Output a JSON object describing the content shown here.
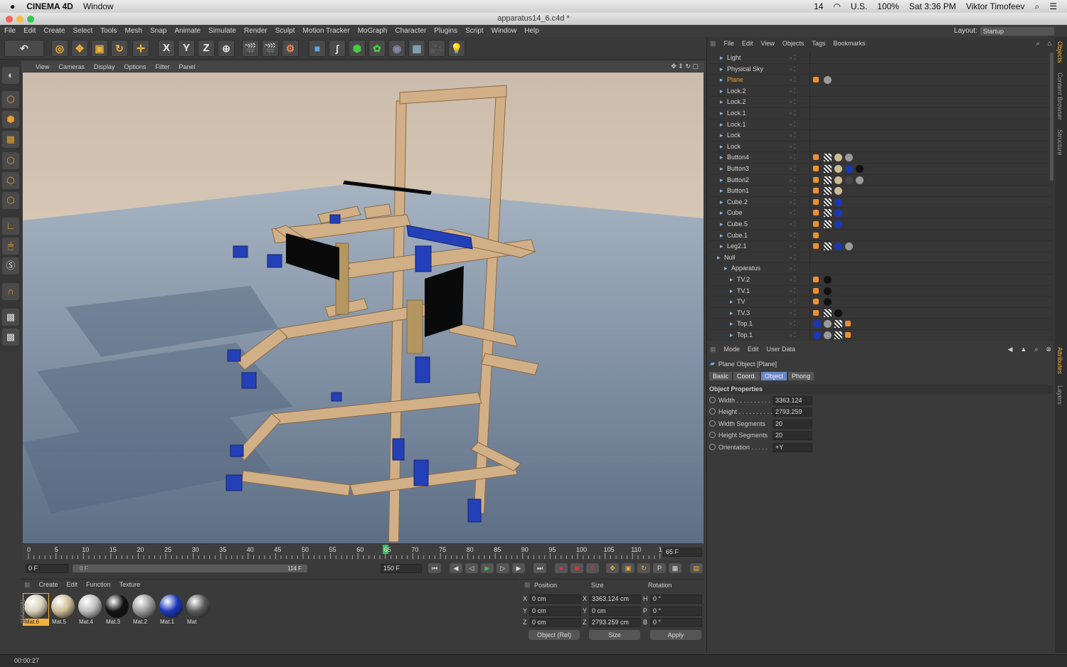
{
  "mac_menubar": {
    "app": "CINEMA 4D",
    "window_menu": "Window",
    "status": [
      "14",
      "U.S.",
      "100%",
      "Sat 3:36 PM",
      "Viktor Timofeev"
    ]
  },
  "window": {
    "title": "apparatus14_6.c4d *"
  },
  "menu": [
    "File",
    "Edit",
    "Create",
    "Select",
    "Tools",
    "Mesh",
    "Snap",
    "Animate",
    "Simulate",
    "Render",
    "Sculpt",
    "Motion Tracker",
    "MoGraph",
    "Character",
    "Plugins",
    "Script",
    "Window",
    "Help"
  ],
  "layout": {
    "label": "Layout:",
    "value": "Startup"
  },
  "toolbar": {
    "axis": [
      "X",
      "Y",
      "Z"
    ]
  },
  "viewport_menu": [
    "View",
    "Cameras",
    "Display",
    "Options",
    "Filter",
    "Panel"
  ],
  "object_manager": {
    "menu": [
      "File",
      "Edit",
      "View",
      "Objects",
      "Tags",
      "Bookmarks"
    ],
    "items": [
      {
        "name": "Light",
        "selected": false
      },
      {
        "name": "Physical Sky",
        "selected": false
      },
      {
        "name": "Plane",
        "selected": true
      },
      {
        "name": "Lock.2",
        "selected": false
      },
      {
        "name": "Lock.2",
        "selected": false
      },
      {
        "name": "Lock.1",
        "selected": false
      },
      {
        "name": "Lock.1",
        "selected": false
      },
      {
        "name": "Lock",
        "selected": false
      },
      {
        "name": "Lock",
        "selected": false
      },
      {
        "name": "Button4",
        "selected": false
      },
      {
        "name": "Button3",
        "selected": false
      },
      {
        "name": "Button2",
        "selected": false
      },
      {
        "name": "Button1",
        "selected": false
      },
      {
        "name": "Cube.2",
        "selected": false
      },
      {
        "name": "Cube",
        "selected": false
      },
      {
        "name": "Cube.5",
        "selected": false
      },
      {
        "name": "Cube.1",
        "selected": false
      },
      {
        "name": "Leg2.1",
        "selected": false
      },
      {
        "name": "Null",
        "selected": false
      },
      {
        "name": "Apparatus",
        "selected": false
      },
      {
        "name": "TV.2",
        "selected": false
      },
      {
        "name": "TV.1",
        "selected": false
      },
      {
        "name": "TV",
        "selected": false
      },
      {
        "name": "TV.3",
        "selected": false
      },
      {
        "name": "Top.1",
        "selected": false
      },
      {
        "name": "Top.1",
        "selected": false
      }
    ]
  },
  "attributes": {
    "menu": [
      "Mode",
      "Edit",
      "User Data"
    ],
    "object_title": "Plane Object [Plane]",
    "tabs": [
      "Basic",
      "Coord.",
      "Object",
      "Phong"
    ],
    "active_tab": "Object",
    "section": "Object Properties",
    "props": [
      {
        "label": "Width . . . . . . . . . . .",
        "value": "3363.124"
      },
      {
        "label": "Height . . . . . . . . . .",
        "value": "2793.259"
      },
      {
        "label": "Width Segments",
        "value": "20"
      },
      {
        "label": "Height Segments",
        "value": "20"
      },
      {
        "label": "Orientation . . . . .",
        "value": "+Y"
      }
    ]
  },
  "side_tabs": [
    "Objects",
    "Content Browser",
    "Structure",
    "Attributes",
    "Layers"
  ],
  "timeline": {
    "ticks": [
      "0",
      "5",
      "10",
      "15",
      "20",
      "25",
      "30",
      "35",
      "40",
      "45",
      "50",
      "55",
      "60",
      "65",
      "70",
      "75",
      "80",
      "85",
      "90",
      "95",
      "100",
      "105",
      "110",
      "1"
    ],
    "current_frame": "65",
    "frame_field": "65 F",
    "start": "0 F",
    "range_start": "0 F",
    "range_end": "114 F",
    "end": "150 F"
  },
  "materials": {
    "menu": [
      "Create",
      "Edit",
      "Function",
      "Texture"
    ],
    "items": [
      {
        "name": "Mat.6",
        "color": "#d8cfb8"
      },
      {
        "name": "Mat.5",
        "color": "#cdbb93"
      },
      {
        "name": "Mat.4",
        "color": "#bdbdbd"
      },
      {
        "name": "Mat.3",
        "color": "#111111"
      },
      {
        "name": "Mat.2",
        "color": "#9a9a9a"
      },
      {
        "name": "Mat.1",
        "color": "#1a37b8"
      },
      {
        "name": "Mat",
        "color": "#5a5a5a"
      }
    ]
  },
  "coords": {
    "headers": [
      "Position",
      "Size",
      "Rotation"
    ],
    "rows": [
      {
        "axis": "X",
        "pos": "0 cm",
        "size_axis": "X",
        "size": "3363.124 cm",
        "rot_axis": "H",
        "rot": "0 °"
      },
      {
        "axis": "Y",
        "pos": "0 cm",
        "size_axis": "Y",
        "size": "0 cm",
        "rot_axis": "P",
        "rot": "0 °"
      },
      {
        "axis": "Z",
        "pos": "0 cm",
        "size_axis": "Z",
        "size": "2793.259 cm",
        "rot_axis": "B",
        "rot": "0 °"
      }
    ],
    "mode": "Object (Rel)",
    "size_mode": "Size",
    "apply": "Apply"
  },
  "status": {
    "time": "00:00:27"
  },
  "colors": {
    "accent": "#f1b33b",
    "selected_text": "#f0a020",
    "highlight_blue": "#6a88c8"
  }
}
